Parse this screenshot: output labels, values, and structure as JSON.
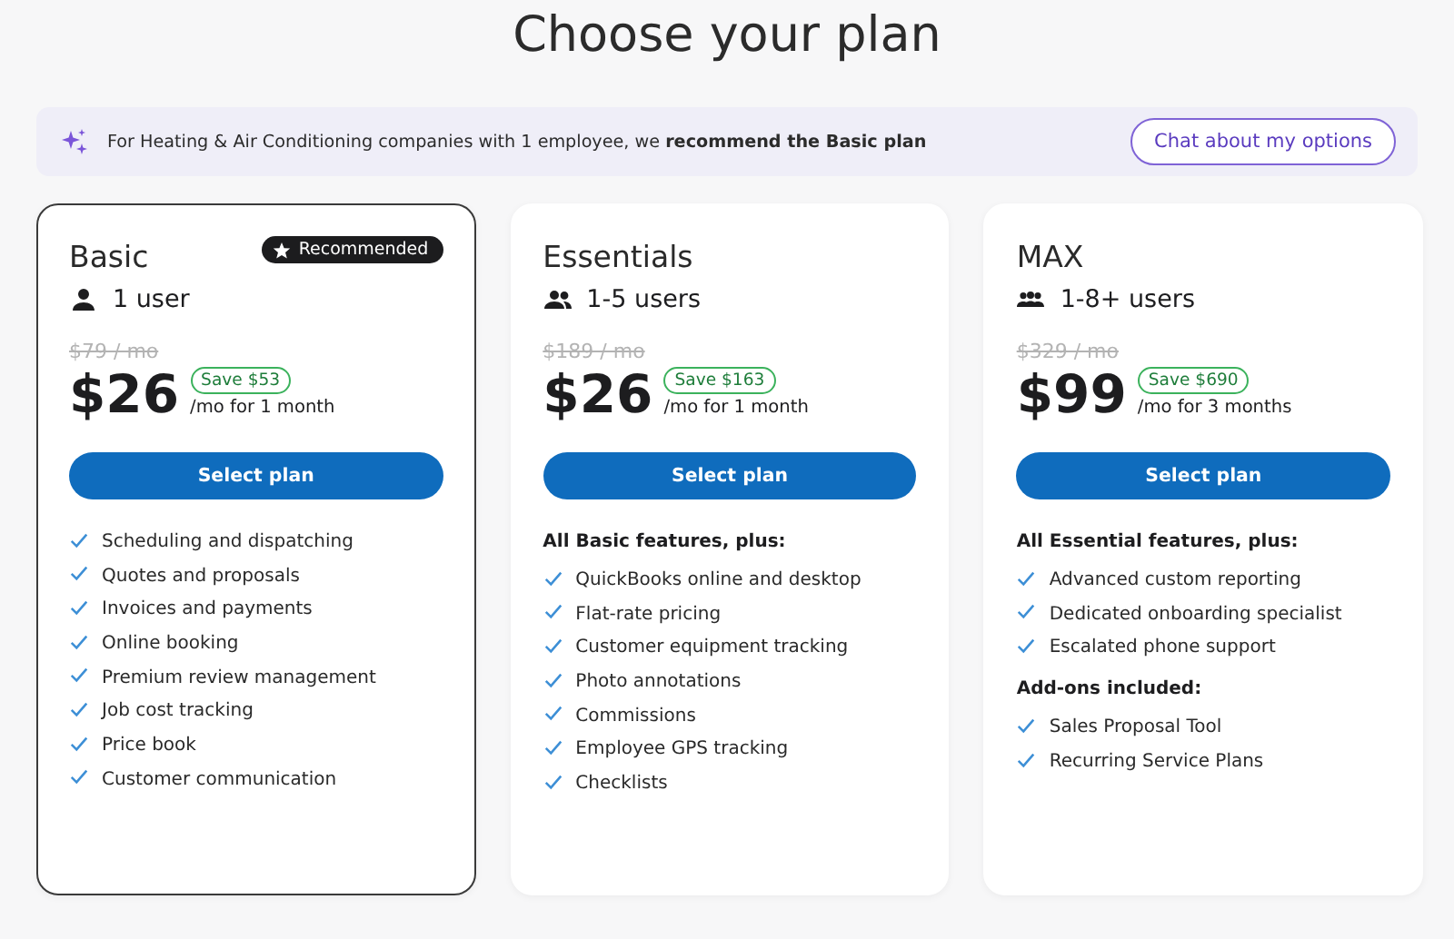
{
  "title": "Choose your plan",
  "banner": {
    "text": "For Heating & Air Conditioning companies with 1 employee, we **recommend the Basic plan**",
    "button": "Chat about my options"
  },
  "plans": [
    {
      "name": "Basic",
      "selected": true,
      "badge": "Recommended",
      "kind": "single",
      "users": "1 user",
      "old_price": "$79 / mo",
      "price": "$26",
      "save": "Save $53",
      "term": "/mo for 1 month",
      "button": "Select plan",
      "sections": [
        {
          "features": [
            "Scheduling and dispatching",
            "Quotes and proposals",
            "Invoices and payments",
            "Online booking",
            "Premium review management",
            "Job cost tracking",
            "Price book",
            "Customer communication"
          ]
        }
      ]
    },
    {
      "name": "Essentials",
      "selected": false,
      "kind": "pair",
      "users": "1-5 users",
      "old_price": "$189 / mo",
      "price": "$26",
      "save": "Save $163",
      "term": "/mo for 1 month",
      "button": "Select plan",
      "sections": [
        {
          "heading": "All Basic features, plus:",
          "features": [
            "QuickBooks online and desktop",
            "Flat-rate pricing",
            "Customer equipment tracking",
            "Photo annotations",
            "Commissions",
            "Employee GPS tracking",
            "Checklists"
          ]
        }
      ]
    },
    {
      "name": "MAX",
      "selected": false,
      "kind": "group",
      "users": "1-8+ users",
      "old_price": "$329 / mo",
      "price": "$99",
      "save": "Save $690",
      "term": "/mo for 3 months",
      "button": "Select plan",
      "sections": [
        {
          "heading": "All Essential features, plus:",
          "features": [
            "Advanced custom reporting",
            "Dedicated onboarding specialist",
            "Escalated phone support"
          ]
        },
        {
          "heading": "Add-ons included:",
          "features": [
            "Sales Proposal Tool",
            "Recurring Service Plans"
          ]
        }
      ]
    }
  ]
}
